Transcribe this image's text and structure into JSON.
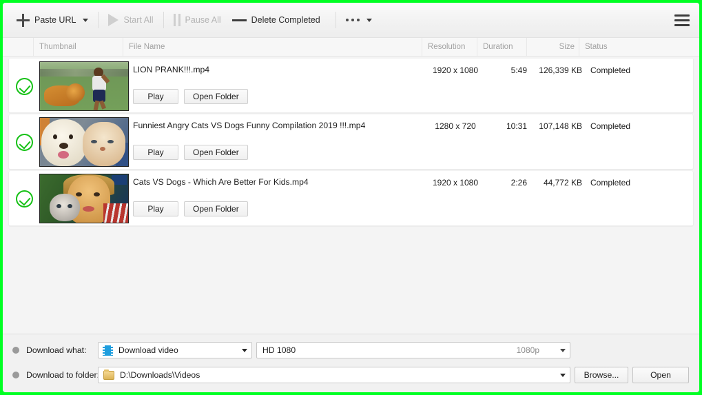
{
  "toolbar": {
    "paste_url": "Paste URL",
    "start_all": "Start All",
    "pause_all": "Pause All",
    "delete_completed": "Delete Completed",
    "more_icon": "more-dots-icon",
    "menu_icon": "hamburger-menu-icon"
  },
  "columns": {
    "thumbnail": "Thumbnail",
    "file_name": "File Name",
    "resolution": "Resolution",
    "duration": "Duration",
    "size": "Size",
    "status": "Status"
  },
  "row_buttons": {
    "play": "Play",
    "open_folder": "Open Folder"
  },
  "downloads": [
    {
      "file_name": "LION PRANK!!!.mp4",
      "resolution": "1920 x 1080",
      "duration": "5:49",
      "size": "126,339 KB",
      "status": "Completed",
      "check_icon": "check-circle-icon",
      "thumb_alt": "dog-dressed-as-lion-chasing-boy"
    },
    {
      "file_name": "Funniest Angry Cats VS Dogs Funny Compilation 2019 !!!.mp4",
      "resolution": "1280 x 720",
      "duration": "10:31",
      "size": "107,148 KB",
      "status": "Completed",
      "check_icon": "check-circle-icon",
      "thumb_alt": "white-dog-and-ginger-cat"
    },
    {
      "file_name": "Cats VS Dogs - Which Are Better For Kids.mp4",
      "resolution": "1920 x 1080",
      "duration": "2:26",
      "size": "44,772 KB",
      "status": "Completed",
      "check_icon": "check-circle-icon",
      "thumb_alt": "girl-holding-kitten"
    }
  ],
  "bottom": {
    "download_what_label": "Download what:",
    "download_what_value": "Download video",
    "download_what_icon": "film-strip-icon",
    "quality_value": "HD 1080",
    "quality_suffix": "1080p",
    "download_to_label": "Download to folder:",
    "folder_value": "D:\\Downloads\\Videos",
    "folder_icon": "folder-icon",
    "browse": "Browse...",
    "open": "Open"
  },
  "colors": {
    "highlight_border": "#00ff22",
    "check_green": "#16c116",
    "film_blue": "#1f9ede"
  }
}
